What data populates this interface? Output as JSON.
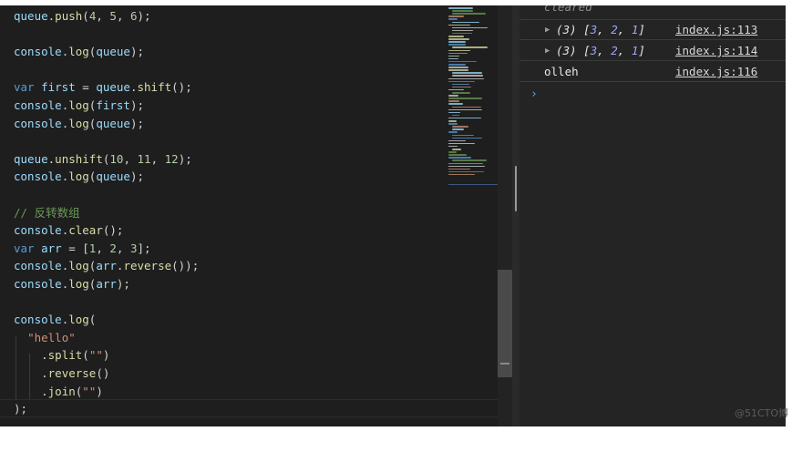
{
  "editor": {
    "lines": [
      [
        {
          "t": "queue",
          "c": "v"
        },
        {
          "t": ".",
          "c": "p"
        },
        {
          "t": "push",
          "c": "f"
        },
        {
          "t": "(",
          "c": "p"
        },
        {
          "t": "4",
          "c": "n"
        },
        {
          "t": ", ",
          "c": "p"
        },
        {
          "t": "5",
          "c": "n"
        },
        {
          "t": ", ",
          "c": "p"
        },
        {
          "t": "6",
          "c": "n"
        },
        {
          "t": ");",
          "c": "p"
        }
      ],
      [],
      [
        {
          "t": "console",
          "c": "v"
        },
        {
          "t": ".",
          "c": "p"
        },
        {
          "t": "log",
          "c": "f"
        },
        {
          "t": "(",
          "c": "p"
        },
        {
          "t": "queue",
          "c": "v"
        },
        {
          "t": ");",
          "c": "p"
        }
      ],
      [],
      [
        {
          "t": "var",
          "c": "k"
        },
        {
          "t": " ",
          "c": "p"
        },
        {
          "t": "first",
          "c": "v"
        },
        {
          "t": " = ",
          "c": "p"
        },
        {
          "t": "queue",
          "c": "v"
        },
        {
          "t": ".",
          "c": "p"
        },
        {
          "t": "shift",
          "c": "f"
        },
        {
          "t": "();",
          "c": "p"
        }
      ],
      [
        {
          "t": "console",
          "c": "v"
        },
        {
          "t": ".",
          "c": "p"
        },
        {
          "t": "log",
          "c": "f"
        },
        {
          "t": "(",
          "c": "p"
        },
        {
          "t": "first",
          "c": "v"
        },
        {
          "t": ");",
          "c": "p"
        }
      ],
      [
        {
          "t": "console",
          "c": "v"
        },
        {
          "t": ".",
          "c": "p"
        },
        {
          "t": "log",
          "c": "f"
        },
        {
          "t": "(",
          "c": "p"
        },
        {
          "t": "queue",
          "c": "v"
        },
        {
          "t": ");",
          "c": "p"
        }
      ],
      [],
      [
        {
          "t": "queue",
          "c": "v"
        },
        {
          "t": ".",
          "c": "p"
        },
        {
          "t": "unshift",
          "c": "f"
        },
        {
          "t": "(",
          "c": "p"
        },
        {
          "t": "10",
          "c": "n"
        },
        {
          "t": ", ",
          "c": "p"
        },
        {
          "t": "11",
          "c": "n"
        },
        {
          "t": ", ",
          "c": "p"
        },
        {
          "t": "12",
          "c": "n"
        },
        {
          "t": ");",
          "c": "p"
        }
      ],
      [
        {
          "t": "console",
          "c": "v"
        },
        {
          "t": ".",
          "c": "p"
        },
        {
          "t": "log",
          "c": "f"
        },
        {
          "t": "(",
          "c": "p"
        },
        {
          "t": "queue",
          "c": "v"
        },
        {
          "t": ");",
          "c": "p"
        }
      ],
      [],
      [
        {
          "t": "// 反转数组",
          "c": "c"
        }
      ],
      [
        {
          "t": "console",
          "c": "v"
        },
        {
          "t": ".",
          "c": "p"
        },
        {
          "t": "clear",
          "c": "f"
        },
        {
          "t": "();",
          "c": "p"
        }
      ],
      [
        {
          "t": "var",
          "c": "k"
        },
        {
          "t": " ",
          "c": "p"
        },
        {
          "t": "arr",
          "c": "v"
        },
        {
          "t": " = [",
          "c": "p"
        },
        {
          "t": "1",
          "c": "n"
        },
        {
          "t": ", ",
          "c": "p"
        },
        {
          "t": "2",
          "c": "n"
        },
        {
          "t": ", ",
          "c": "p"
        },
        {
          "t": "3",
          "c": "n"
        },
        {
          "t": "];",
          "c": "p"
        }
      ],
      [
        {
          "t": "console",
          "c": "v"
        },
        {
          "t": ".",
          "c": "p"
        },
        {
          "t": "log",
          "c": "f"
        },
        {
          "t": "(",
          "c": "p"
        },
        {
          "t": "arr",
          "c": "v"
        },
        {
          "t": ".",
          "c": "p"
        },
        {
          "t": "reverse",
          "c": "f"
        },
        {
          "t": "());",
          "c": "p"
        }
      ],
      [
        {
          "t": "console",
          "c": "v"
        },
        {
          "t": ".",
          "c": "p"
        },
        {
          "t": "log",
          "c": "f"
        },
        {
          "t": "(",
          "c": "p"
        },
        {
          "t": "arr",
          "c": "v"
        },
        {
          "t": ");",
          "c": "p"
        }
      ],
      [],
      [
        {
          "t": "console",
          "c": "v"
        },
        {
          "t": ".",
          "c": "p"
        },
        {
          "t": "log",
          "c": "f"
        },
        {
          "t": "(",
          "c": "p"
        }
      ],
      [
        {
          "t": "  ",
          "c": "p"
        },
        {
          "t": "\"hello\"",
          "c": "s"
        }
      ],
      [
        {
          "t": "    .",
          "c": "p"
        },
        {
          "t": "split",
          "c": "f"
        },
        {
          "t": "(",
          "c": "p"
        },
        {
          "t": "\"\"",
          "c": "s"
        },
        {
          "t": ")",
          "c": "p"
        }
      ],
      [
        {
          "t": "    .",
          "c": "p"
        },
        {
          "t": "reverse",
          "c": "f"
        },
        {
          "t": "()",
          "c": "p"
        }
      ],
      [
        {
          "t": "    .",
          "c": "p"
        },
        {
          "t": "join",
          "c": "f"
        },
        {
          "t": "(",
          "c": "p"
        },
        {
          "t": "\"\"",
          "c": "s"
        },
        {
          "t": ")",
          "c": "p"
        }
      ],
      [
        {
          "t": ");",
          "c": "p"
        }
      ]
    ]
  },
  "console": {
    "cleared_text": "cleared",
    "rows": [
      {
        "expand": "▶",
        "count": "(3)",
        "open": "[",
        "items": [
          "3",
          "2",
          "1"
        ],
        "close": "]",
        "link": "index.js:113"
      },
      {
        "expand": "▶",
        "count": "(3)",
        "open": "[",
        "items": [
          "3",
          "2",
          "1"
        ],
        "close": "]",
        "link": "index.js:114"
      }
    ],
    "string_row": {
      "text": "olleh",
      "link": "index.js:116"
    },
    "prompt": "›"
  },
  "watermark": "@51CTO博"
}
